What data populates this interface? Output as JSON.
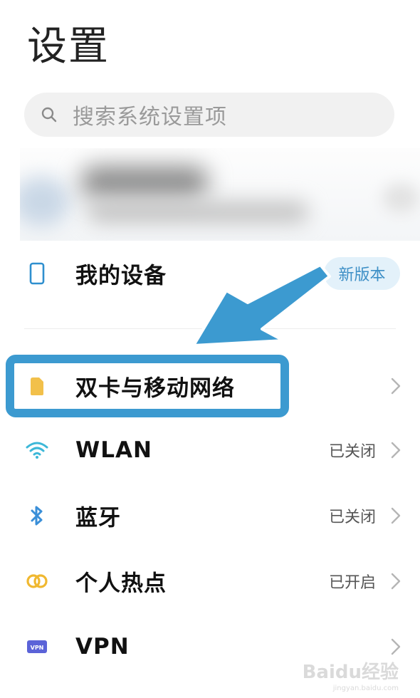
{
  "header": {
    "title": "设置"
  },
  "search": {
    "placeholder": "搜索系统设置项",
    "icon": "search-icon"
  },
  "account": {
    "note": ""
  },
  "my_device": {
    "label": "我的设备",
    "badge": "新版本",
    "icon": "phone-outline-icon"
  },
  "rows": [
    {
      "label": "双卡与移动网络",
      "status": "",
      "icon": "sim-card-icon",
      "icon_color": "#f2c04a"
    },
    {
      "label": "WLAN",
      "status": "已关闭",
      "icon": "wifi-icon",
      "icon_color": "#3db8d8"
    },
    {
      "label": "蓝牙",
      "status": "已关闭",
      "icon": "bluetooth-icon",
      "icon_color": "#3a8fd8"
    },
    {
      "label": "个人热点",
      "status": "已开启",
      "icon": "hotspot-icon",
      "icon_color": "#f0b830"
    },
    {
      "label": "VPN",
      "status": "",
      "icon": "vpn-icon",
      "icon_color": "#5b63d8",
      "icon_text": "VPN"
    }
  ],
  "colors": {
    "accent": "#3c9ad0",
    "badge_bg": "#e3f1fa",
    "badge_text": "#3d8fc6"
  },
  "watermark": {
    "main": "Baidu经验",
    "sub": "jingyan.baidu.com"
  }
}
